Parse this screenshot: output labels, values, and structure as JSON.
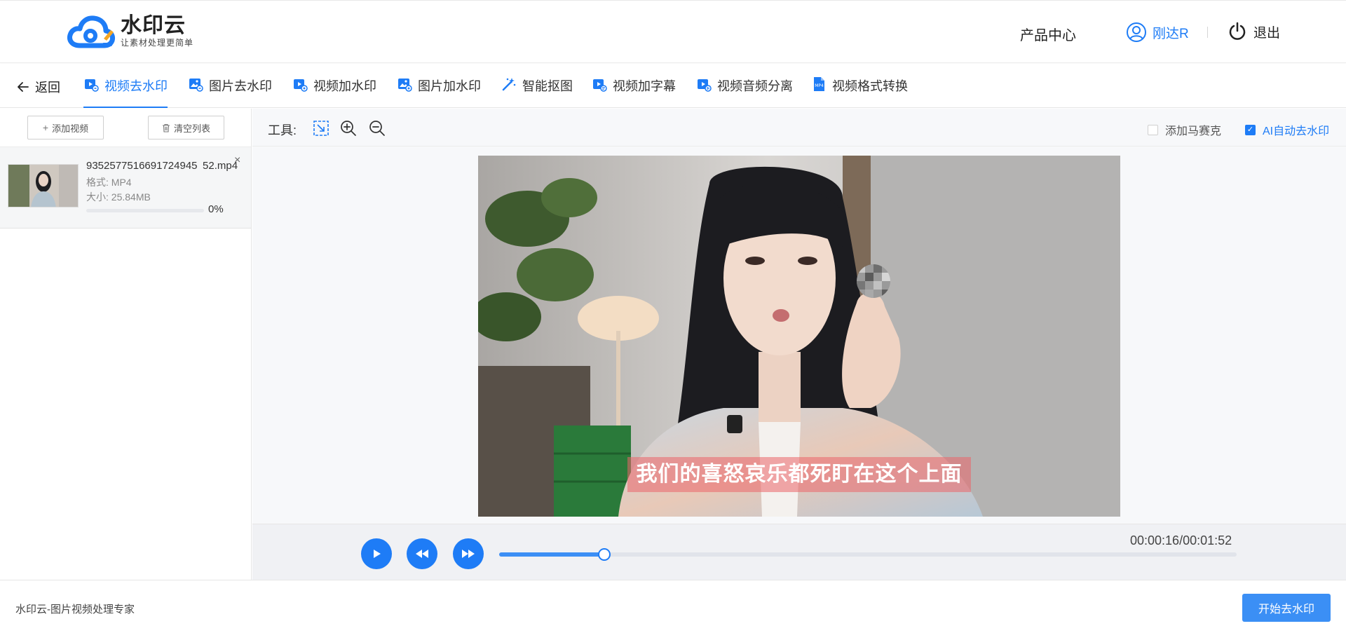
{
  "header": {
    "logo_name": "水印云",
    "logo_slogan": "让素材处理更简单",
    "product_center": "产品中心",
    "username": "刚达R",
    "logout": "退出"
  },
  "nav": {
    "back": "返回",
    "tabs": [
      {
        "label": "视频去水印",
        "icon": "video-remove-icon",
        "active": true
      },
      {
        "label": "图片去水印",
        "icon": "image-remove-icon",
        "active": false
      },
      {
        "label": "视频加水印",
        "icon": "video-add-icon",
        "active": false
      },
      {
        "label": "图片加水印",
        "icon": "image-add-icon",
        "active": false
      },
      {
        "label": "智能抠图",
        "icon": "magic-wand-icon",
        "active": false
      },
      {
        "label": "视频加字幕",
        "icon": "video-subtitle-icon",
        "active": false
      },
      {
        "label": "视频音频分离",
        "icon": "audio-split-icon",
        "active": false
      },
      {
        "label": "视频格式转换",
        "icon": "mp4-convert-icon",
        "active": false
      }
    ]
  },
  "left": {
    "add_video": "添加视频",
    "clear_list": "清空列表",
    "file": {
      "name": "9352577516691724945 52.mp4",
      "format": "格式: MP4",
      "size": "大小: 25.84MB",
      "progress": 0,
      "progress_text": "0%"
    }
  },
  "toolbar": {
    "label": "工具:",
    "add_mosaic": "添加马赛克",
    "add_mosaic_checked": false,
    "ai_remove": "AI自动去水印",
    "ai_remove_checked": true
  },
  "video": {
    "subtitle": "我们的喜怒哀乐都死盯在这个上面"
  },
  "player": {
    "current": "00:00:16",
    "duration": "00:01:52",
    "time_text": "00:00:16/00:01:52",
    "progress": 0.143
  },
  "footer": {
    "brand": "水印云-图片视频处理专家",
    "start": "开始去水印"
  },
  "colors": {
    "accent": "#1E7CF6",
    "button": "#3B8FF5"
  }
}
